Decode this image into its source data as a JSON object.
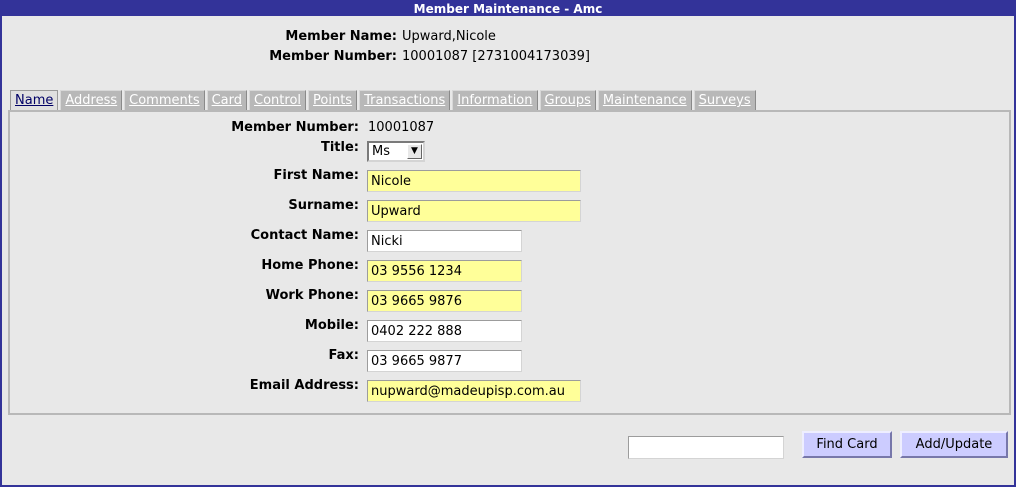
{
  "window": {
    "title": "Member Maintenance - Amc"
  },
  "summary": {
    "member_name_label": "Member Name:",
    "member_name_value": "Upward,Nicole",
    "member_number_label": "Member Number:",
    "member_number_value": "10001087 [2731004173039]"
  },
  "tabs": [
    "Name",
    "Address",
    "Comments",
    "Card",
    "Control",
    "Points",
    "Transactions",
    "Information",
    "Groups",
    "Maintenance",
    "Surveys"
  ],
  "active_tab": "Name",
  "form": {
    "member_number_label": "Member Number:",
    "member_number_value": "10001087",
    "title_label": "Title:",
    "title_value": "Ms",
    "first_name_label": "First Name:",
    "first_name_value": "Nicole",
    "surname_label": "Surname:",
    "surname_value": "Upward",
    "contact_name_label": "Contact Name:",
    "contact_name_value": "Nicki",
    "home_phone_label": "Home Phone:",
    "home_phone_value": "03 9556 1234",
    "work_phone_label": "Work Phone:",
    "work_phone_value": "03 9665 9876",
    "mobile_label": "Mobile:",
    "mobile_value": "0402 222 888",
    "fax_label": "Fax:",
    "fax_value": "03 9665 9877",
    "email_label": "Email Address:",
    "email_value": "nupward@madeupisp.com.au"
  },
  "footer": {
    "find_card_value": "",
    "find_card_label": "Find Card",
    "add_update_label": "Add/Update"
  },
  "colors": {
    "titlebar": "#333399",
    "required_field": "#ffff99",
    "button": "#ccccff",
    "tab": "#b8b8b8"
  }
}
